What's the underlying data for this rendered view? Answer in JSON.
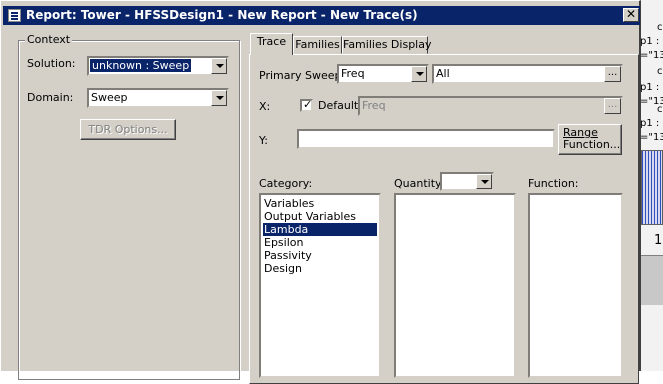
{
  "window": {
    "title": "Report: Tower - HFSSDesign1 - New Report - New Trace(s)",
    "close_glyph": "✕"
  },
  "context": {
    "group_label": "Context",
    "solution_label": "Solution:",
    "solution_value": "unknown : Sweep",
    "domain_label": "Domain:",
    "domain_value": "Sweep",
    "tdr_button": "TDR Options..."
  },
  "tabs": [
    {
      "label": "Trace",
      "active": true
    },
    {
      "label": "Families",
      "active": false
    },
    {
      "label": "Families Display",
      "active": false
    }
  ],
  "trace": {
    "primary_sweep_label": "Primary Sweep:",
    "primary_sweep_value": "Freq",
    "primary_sweep_range": "All",
    "x_label": "X:",
    "default_label": "Default",
    "default_checked": true,
    "x_value": "Freq",
    "y_label": "Y:",
    "y_value": "",
    "range_function_button_line1": "Range",
    "range_function_button_line2": "Function...",
    "ellipsis": "..."
  },
  "selectors": {
    "category_label": "Category:",
    "categories": [
      "Variables",
      "Output Variables",
      "Lambda",
      "Epsilon",
      "Passivity",
      "Design"
    ],
    "selected_category": "Lambda",
    "quantity_label": "Quantity:",
    "quantity_value": "",
    "function_label": "Function:"
  },
  "background_app": {
    "fragments": [
      "c",
      "p1 :",
      "=\"13",
      "c",
      "p1 :",
      "=\"13",
      "c",
      "p1 :",
      "=\"13",
      "1"
    ]
  }
}
